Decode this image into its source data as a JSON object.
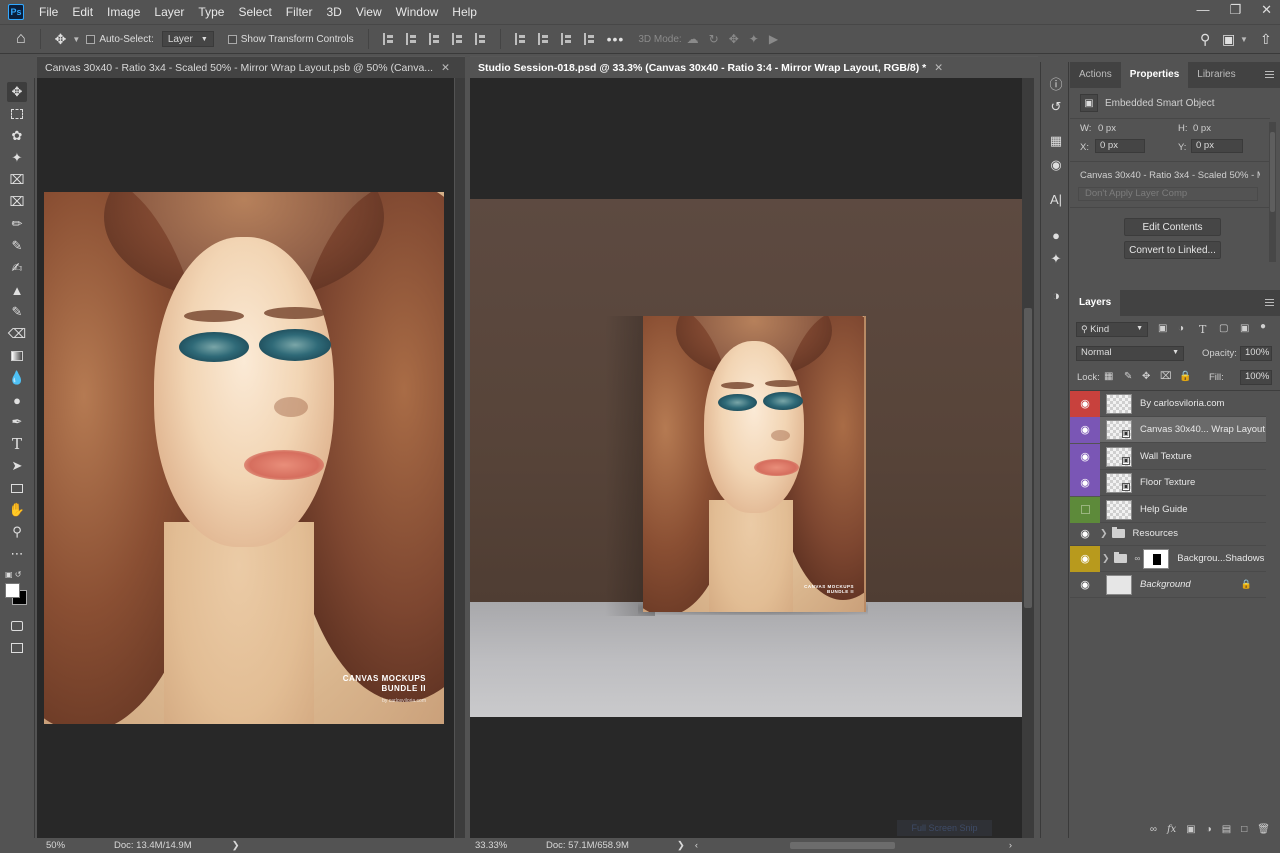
{
  "app": {
    "logo_text": "Ps"
  },
  "menu": [
    "File",
    "Edit",
    "Image",
    "Layer",
    "Type",
    "Select",
    "Filter",
    "3D",
    "View",
    "Window",
    "Help"
  ],
  "options": {
    "auto_select_label": "Auto-Select:",
    "auto_select_target": "Layer",
    "transform_label": "Show Transform Controls",
    "mode3d_label": "3D Mode:"
  },
  "documents": [
    {
      "tab_title": "Canvas 30x40 - Ratio 3x4 - Scaled 50% - Mirror Wrap Layout.psb @ 50% (Canva...",
      "zoom": "50%",
      "doc_size": "Doc: 13.4M/14.9M"
    },
    {
      "tab_title": "Studio Session-018.psd @ 33.3% (Canvas 30x40 - Ratio 3:4 - Mirror Wrap Layout, RGB/8) *",
      "zoom": "33.33%",
      "doc_size": "Doc: 57.1M/658.9M",
      "watermark": "Full Screen Snip"
    }
  ],
  "artwork": {
    "line1": "CANVAS MOCKUPS",
    "line2": "BUNDLE II",
    "credit": "by carlosviloria.com"
  },
  "properties": {
    "tabs": [
      "Actions",
      "Properties",
      "Libraries"
    ],
    "active_tab": "Properties",
    "object_type": "Embedded Smart Object",
    "w_label": "W:",
    "w_value": "0 px",
    "h_label": "H:",
    "h_value": "0 px",
    "x_label": "X:",
    "x_value": "0 px",
    "y_label": "Y:",
    "y_value": "0 px",
    "layer_name": "Canvas 30x40 - Ratio 3x4 - Scaled 50% - M...",
    "layer_comp": "Don't Apply Layer Comp",
    "edit_contents": "Edit Contents",
    "convert_linked": "Convert to Linked..."
  },
  "layers_panel": {
    "title": "Layers",
    "filter_kind": "Kind",
    "blend_mode": "Normal",
    "opacity_label": "Opacity:",
    "opacity_value": "100%",
    "lock_label": "Lock:",
    "fill_label": "Fill:",
    "fill_value": "100%",
    "layers": [
      {
        "name": "By carlosviloria.com",
        "color": "#c8413d",
        "visible": true
      },
      {
        "name": "Canvas 30x40... Wrap Layout",
        "color": "#7a56b5",
        "visible": true,
        "selected": true
      },
      {
        "name": "Wall Texture",
        "color": "#7a56b5",
        "visible": true
      },
      {
        "name": "Floor Texture",
        "color": "#7a56b5",
        "visible": true
      },
      {
        "name": "Help Guide",
        "color": "#5d8a3a",
        "visible": false
      },
      {
        "name": "Resources",
        "color": "",
        "visible": true,
        "folder": true
      },
      {
        "name": "Backgrou...Shadows",
        "color": "#b89a1d",
        "visible": true,
        "folder": true
      },
      {
        "name": "Background",
        "color": "",
        "visible": true,
        "italic": true,
        "locked": true
      }
    ]
  }
}
